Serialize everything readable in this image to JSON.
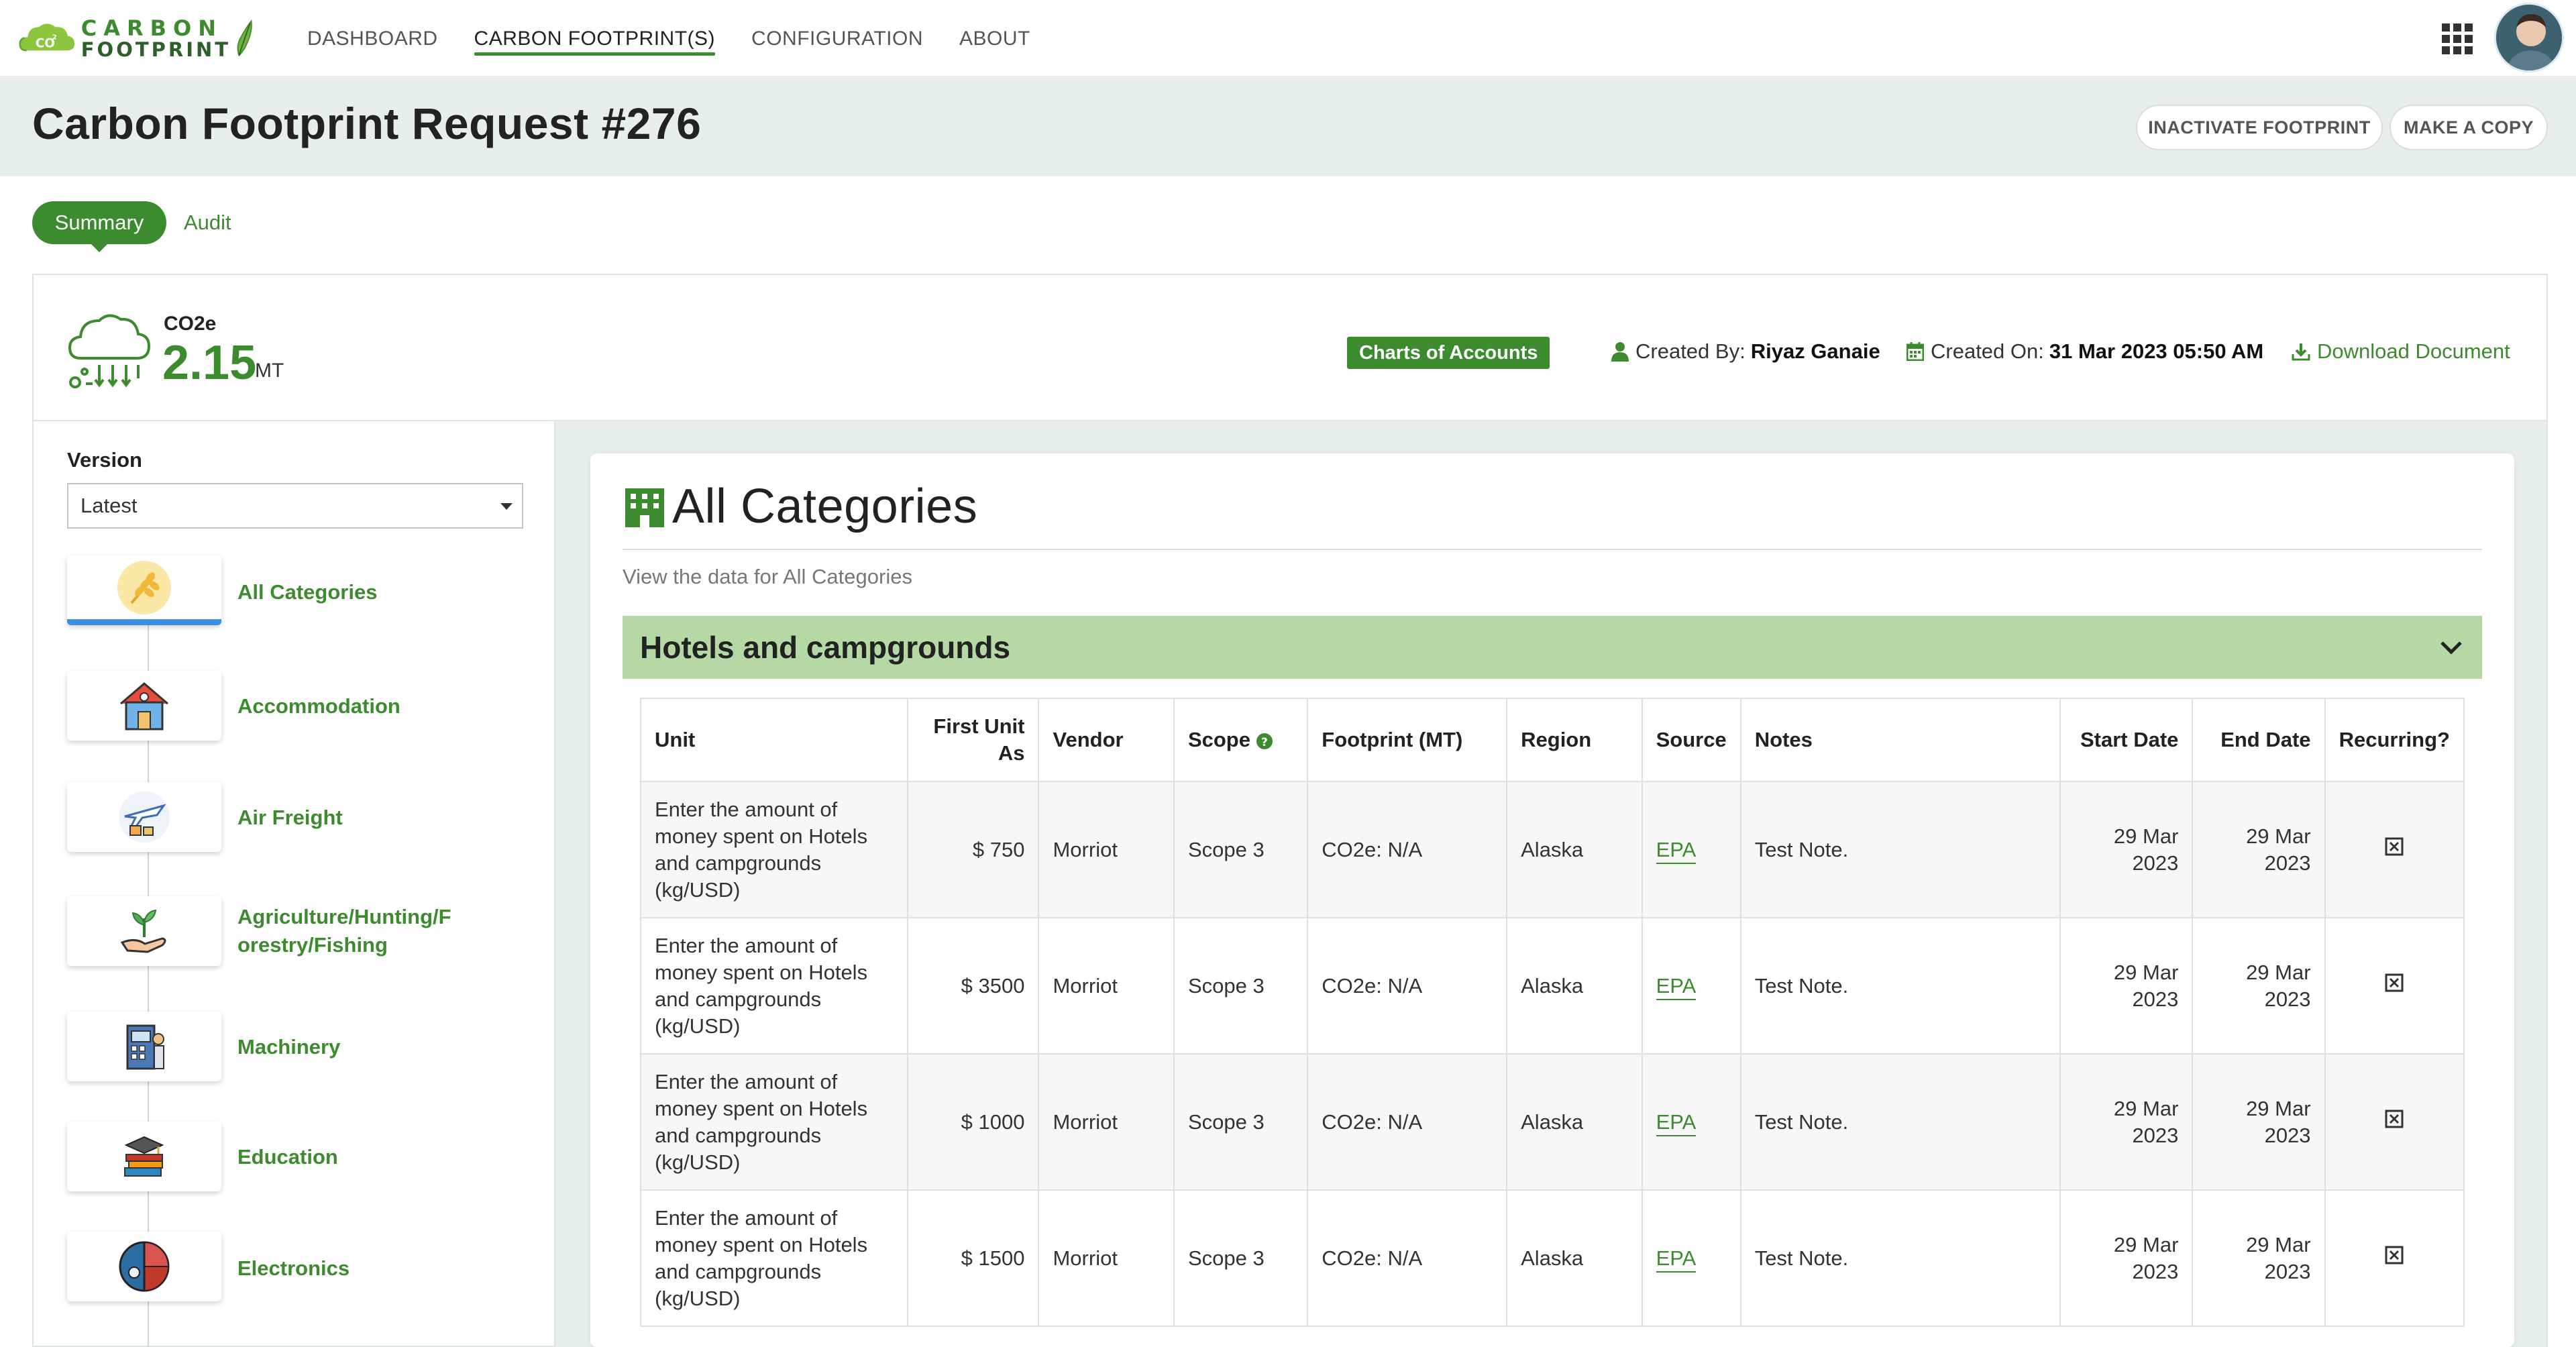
{
  "brand": {
    "line1": "CARBON",
    "line2": "FOOTPRINT",
    "mark_text": "CO",
    "colors": {
      "primary": "#3d8b2f",
      "dark": "#2c5f2a",
      "accent_blue": "#3a8fe0",
      "band": "#e7eeee",
      "group_bar": "#b5d8a4"
    }
  },
  "nav": {
    "items": [
      {
        "label": "DASHBOARD"
      },
      {
        "label": "CARBON FOOTPRINT(S)"
      },
      {
        "label": "CONFIGURATION"
      },
      {
        "label": "ABOUT"
      }
    ],
    "active": "CARBON FOOTPRINT(S)",
    "apps_icon": "grid-icon",
    "avatar_icon": "user-avatar"
  },
  "header": {
    "title": "Carbon Footprint Request #276",
    "inactivate_label": "INACTIVATE FOOTPRINT",
    "copy_label": "MAKE A COPY"
  },
  "tabs": [
    {
      "label": "Summary",
      "active": true
    },
    {
      "label": "Audit",
      "active": false
    }
  ],
  "summary": {
    "co2_label": "CO2e",
    "co2_value": "2.15",
    "co2_unit": "MT",
    "badge": "Charts of Accounts",
    "created_by_label": "Created By:",
    "created_by": "Riyaz Ganaie",
    "created_on_label": "Created On:",
    "created_on": "31 Mar 2023 05:50 AM",
    "download_label": "Download Document"
  },
  "sidebar": {
    "version_label": "Version",
    "version_value": "Latest",
    "categories": [
      {
        "label": "All Categories",
        "icon": "wheat-icon",
        "active": true
      },
      {
        "label": "Accommodation",
        "icon": "house-icon",
        "active": false
      },
      {
        "label": "Air Freight",
        "icon": "airplane-icon",
        "active": false
      },
      {
        "label_l1": "Agriculture/Hunting/F",
        "label_l2": "orestry/Fishing",
        "icon": "plant-hand-icon",
        "active": false
      },
      {
        "label": "Machinery",
        "icon": "machine-icon",
        "active": false
      },
      {
        "label": "Education",
        "icon": "books-icon",
        "active": false
      },
      {
        "label": "Electronics",
        "icon": "electronics-icon",
        "active": false
      }
    ]
  },
  "main": {
    "title": "All Categories",
    "title_icon": "building-icon",
    "subtitle": "View the data for All Categories",
    "group": "Hotels and campgrounds",
    "columns": [
      "Unit",
      "First Unit As",
      "Vendor",
      "Scope",
      "Footprint (MT)",
      "Region",
      "Source",
      "Notes",
      "Start Date",
      "End Date",
      "Recurring?"
    ],
    "rows": [
      {
        "unit": "Enter the amount of money spent on Hotels and campgrounds (kg/USD)",
        "first_unit": "$ 750",
        "vendor": "Morriot",
        "scope": "Scope 3",
        "footprint": "CO2e: N/A",
        "region": "Alaska",
        "source": "EPA",
        "notes": "Test Note.",
        "start": "29 Mar 2023",
        "end": "29 Mar 2023",
        "recurring": false
      },
      {
        "unit": "Enter the amount of money spent on Hotels and campgrounds (kg/USD)",
        "first_unit": "$ 3500",
        "vendor": "Morriot",
        "scope": "Scope 3",
        "footprint": "CO2e: N/A",
        "region": "Alaska",
        "source": "EPA",
        "notes": "Test Note.",
        "start": "29 Mar 2023",
        "end": "29 Mar 2023",
        "recurring": false
      },
      {
        "unit": "Enter the amount of money spent on Hotels and campgrounds (kg/USD)",
        "first_unit": "$ 1000",
        "vendor": "Morriot",
        "scope": "Scope 3",
        "footprint": "CO2e: N/A",
        "region": "Alaska",
        "source": "EPA",
        "notes": "Test Note.",
        "start": "29 Mar 2023",
        "end": "29 Mar 2023",
        "recurring": false
      },
      {
        "unit": "Enter the amount of money spent on Hotels and campgrounds (kg/USD)",
        "first_unit": "$ 1500",
        "vendor": "Morriot",
        "scope": "Scope 3",
        "footprint": "CO2e: N/A",
        "region": "Alaska",
        "source": "EPA",
        "notes": "Test Note.",
        "start": "29 Mar 2023",
        "end": "29 Mar 2023",
        "recurring": false
      }
    ]
  }
}
